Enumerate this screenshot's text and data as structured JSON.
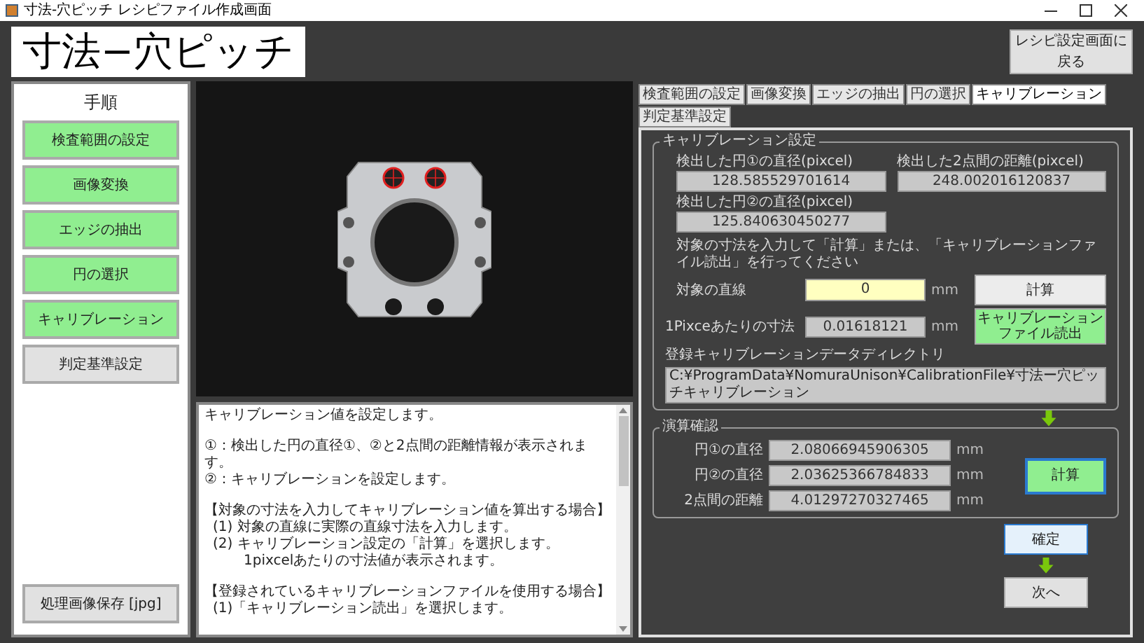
{
  "window": {
    "title": "寸法-穴ピッチ レシピファイル作成画面"
  },
  "header": {
    "title": "寸法−穴ピッチ",
    "back_button": "レシピ設定画面に戻る"
  },
  "steps": {
    "title": "手順",
    "items": [
      {
        "label": "検査範囲の設定",
        "done": true
      },
      {
        "label": "画像変換",
        "done": true
      },
      {
        "label": "エッジの抽出",
        "done": true
      },
      {
        "label": "円の選択",
        "done": true
      },
      {
        "label": "キャリブレーション",
        "done": true
      },
      {
        "label": "判定基準設定",
        "done": false
      }
    ],
    "save_button": "処理画像保存 [jpg]"
  },
  "description": {
    "paragraphs": [
      [
        {
          "kind": "text",
          "text": "キャリブレーション値を設定します。"
        }
      ],
      [
        {
          "kind": "text",
          "text": "①：検出した円の直径①、②と2点間の距離情報が表示されます。"
        },
        {
          "kind": "text",
          "text": "②：キャリブレーションを設定します。"
        }
      ],
      [
        {
          "kind": "heading",
          "text": "【対象の寸法を入力してキャリブレーション値を算出する場合】"
        },
        {
          "kind": "step",
          "text": "(1) 対象の直線に実際の直線寸法を入力します。"
        },
        {
          "kind": "step",
          "text": "(2) キャリブレーション設定の「計算」を選択します。"
        },
        {
          "kind": "note",
          "text": "1pixcelあたりの寸法値が表示されます。"
        }
      ],
      [
        {
          "kind": "heading",
          "text": "【登録されているキャリブレーションファイルを使用する場合】"
        },
        {
          "kind": "step",
          "text": "(1)「キャリブレーション読出」を選択します。"
        }
      ]
    ]
  },
  "tabs": [
    {
      "label": "検査範囲の設定",
      "selected": false
    },
    {
      "label": "画像変換",
      "selected": false
    },
    {
      "label": "エッジの抽出",
      "selected": false
    },
    {
      "label": "円の選択",
      "selected": false
    },
    {
      "label": "キャリブレーション",
      "selected": true
    },
    {
      "label": "判定基準設定",
      "selected": false
    }
  ],
  "calibration": {
    "title": "キャリブレーション設定",
    "circle1_label": "検出した円①の直径(pixcel)",
    "circle1_value": "128.585529701614",
    "distance_label": "検出した2点間の距離(pixcel)",
    "distance_value": "248.002016120837",
    "circle2_label": "検出した円②の直径(pixcel)",
    "circle2_value": "125.840630450277",
    "instruction": "対象の寸法を入力して「計算」または、「キャリブレーションファイル読出」を行ってください",
    "target_label": "対象の直線",
    "target_value": "0",
    "target_unit": "mm",
    "calc_button": "計算",
    "per_pixel_label": "1Pixceあたりの寸法",
    "per_pixel_value": "0.01618121",
    "per_pixel_unit": "mm",
    "load_button": [
      "キャリブレーション",
      "ファイル読出"
    ],
    "dir_label": "登録キャリブレーションデータディレクトリ",
    "dir_value": "C:¥ProgramData¥NomuraUnison¥CalibrationFile¥寸法ー穴ピッチキャリブレーション"
  },
  "result": {
    "title": "演算確認",
    "rows": [
      {
        "label": "円①の直径",
        "value": "2.08066945906305",
        "unit": "mm"
      },
      {
        "label": "円②の直径",
        "value": "2.03625366784833",
        "unit": "mm"
      },
      {
        "label": "2点間の距離",
        "value": "4.01297270327465",
        "unit": "mm"
      }
    ],
    "calc_button": "計算"
  },
  "confirm_button": "確定",
  "next_button": "次へ"
}
